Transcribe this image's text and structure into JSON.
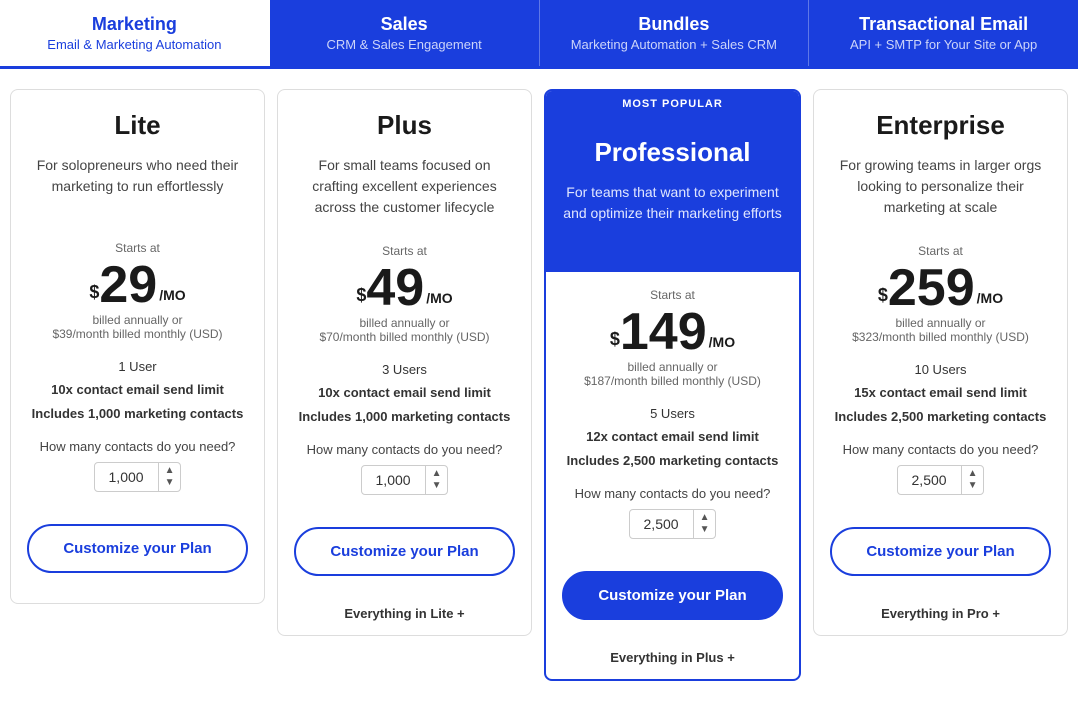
{
  "nav": {
    "tabs": [
      {
        "id": "marketing",
        "title": "Marketing",
        "subtitle": "Email & Marketing Automation",
        "active": true
      },
      {
        "id": "sales",
        "title": "Sales",
        "subtitle": "CRM & Sales Engagement",
        "active": false
      },
      {
        "id": "bundles",
        "title": "Bundles",
        "subtitle": "Marketing Automation + Sales CRM",
        "active": false
      },
      {
        "id": "transactional",
        "title": "Transactional Email",
        "subtitle": "API + SMTP for Your Site or App",
        "active": false
      }
    ]
  },
  "plans": [
    {
      "id": "lite",
      "name": "Lite",
      "popular": false,
      "description": "For solopreneurs who need their marketing to run effortlessly",
      "starts_at": "Starts at",
      "price_dollar": "$",
      "price": "29",
      "price_mo": "/MO",
      "billed_note": "billed annually or\n$39/month billed monthly (USD)",
      "users": "1 User",
      "email_limit": "10x contact email send limit",
      "contacts_included": "Includes 1,000 marketing contacts",
      "contacts_label": "How many contacts do you need?",
      "contacts_value": "1,000",
      "customize_label": "Customize your Plan",
      "btn_style": "outline"
    },
    {
      "id": "plus",
      "name": "Plus",
      "popular": false,
      "description": "For small teams focused on crafting excellent experiences across the customer lifecycle",
      "starts_at": "Starts at",
      "price_dollar": "$",
      "price": "49",
      "price_mo": "/MO",
      "billed_note": "billed annually or\n$70/month billed monthly (USD)",
      "users": "3 Users",
      "email_limit": "10x contact email send limit",
      "contacts_included": "Includes 1,000 marketing contacts",
      "contacts_label": "How many contacts do you need?",
      "contacts_value": "1,000",
      "customize_label": "Customize your Plan",
      "btn_style": "outline",
      "everything_in": "Everything in Lite +"
    },
    {
      "id": "professional",
      "name": "Professional",
      "popular": true,
      "popular_badge": "MOST POPULAR",
      "description": "For teams that want to experiment and optimize their marketing efforts",
      "starts_at": "Starts at",
      "price_dollar": "$",
      "price": "149",
      "price_mo": "/MO",
      "billed_note": "billed annually or\n$187/month billed monthly (USD)",
      "users": "5 Users",
      "email_limit": "12x contact email send limit",
      "contacts_included": "Includes 2,500 marketing contacts",
      "contacts_label": "How many contacts do you need?",
      "contacts_value": "2,500",
      "customize_label": "Customize your Plan",
      "btn_style": "filled",
      "everything_in": "Everything in Plus +"
    },
    {
      "id": "enterprise",
      "name": "Enterprise",
      "popular": false,
      "description": "For growing teams in larger orgs looking to personalize their marketing at scale",
      "starts_at": "Starts at",
      "price_dollar": "$",
      "price": "259",
      "price_mo": "/MO",
      "billed_note": "billed annually or\n$323/month billed monthly (USD)",
      "users": "10 Users",
      "email_limit": "15x contact email send limit",
      "contacts_included": "Includes 2,500 marketing contacts",
      "contacts_label": "How many contacts do you need?",
      "contacts_value": "2,500",
      "customize_label": "Customize your Plan",
      "btn_style": "outline",
      "everything_in": "Everything in Pro +"
    }
  ]
}
